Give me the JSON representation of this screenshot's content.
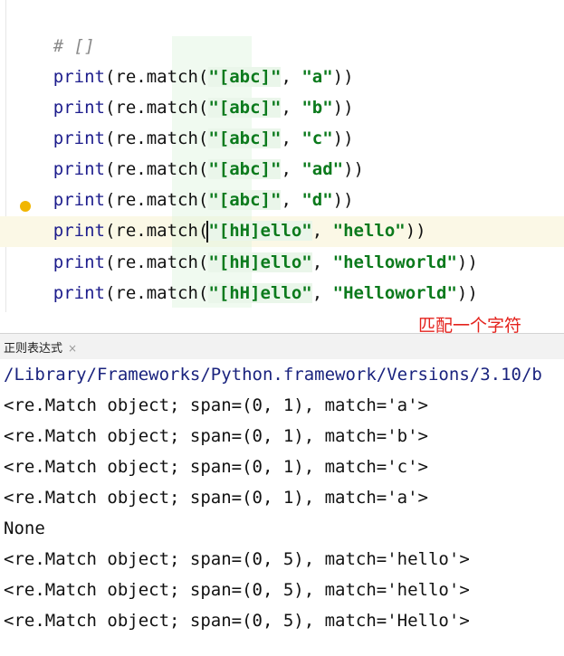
{
  "editor": {
    "comment": "# []",
    "lines": [
      {
        "func": "print",
        "mid": "(re.match(",
        "pattern": "\"[abc]\"",
        "sep": ", ",
        "arg": "\"a\"",
        "end": "))"
      },
      {
        "func": "print",
        "mid": "(re.match(",
        "pattern": "\"[abc]\"",
        "sep": ", ",
        "arg": "\"b\"",
        "end": "))"
      },
      {
        "func": "print",
        "mid": "(re.match(",
        "pattern": "\"[abc]\"",
        "sep": ", ",
        "arg": "\"c\"",
        "end": "))"
      },
      {
        "func": "print",
        "mid": "(re.match(",
        "pattern": "\"[abc]\"",
        "sep": ", ",
        "arg": "\"ad\"",
        "end": "))"
      },
      {
        "func": "print",
        "mid": "(re.match(",
        "pattern": "\"[abc]\"",
        "sep": ", ",
        "arg": "\"d\"",
        "end": "))"
      },
      {
        "func": "print",
        "mid": "(re.match(",
        "pattern": "\"[hH]ello\"",
        "sep": ", ",
        "arg": "\"hello\"",
        "end": "))"
      },
      {
        "func": "print",
        "mid": "(re.match(",
        "pattern": "\"[hH]ello\"",
        "sep": ", ",
        "arg": "\"helloworld\"",
        "end": "))"
      },
      {
        "func": "print",
        "mid": "(re.match(",
        "pattern": "\"[hH]ello\"",
        "sep": ", ",
        "arg": "\"Helloworld\"",
        "end": "))"
      }
    ]
  },
  "annotation": "匹配一个字符",
  "console": {
    "tab_label": "正则表达式",
    "tab_close": "×",
    "path": "/Library/Frameworks/Python.framework/Versions/3.10/b",
    "lines": [
      "<re.Match object; span=(0, 1), match='a'>",
      "<re.Match object; span=(0, 1), match='b'>",
      "<re.Match object; span=(0, 1), match='c'>",
      "<re.Match object; span=(0, 1), match='a'>",
      "None",
      "<re.Match object; span=(0, 5), match='hello'>",
      "<re.Match object; span=(0, 5), match='hello'>",
      "<re.Match object; span=(0, 5), match='Hello'>"
    ]
  },
  "colors": {
    "keyword": "#1c1c8c",
    "string": "#0b7a1c",
    "annotation": "#e4221c",
    "current_line": "#fbf8e6"
  }
}
